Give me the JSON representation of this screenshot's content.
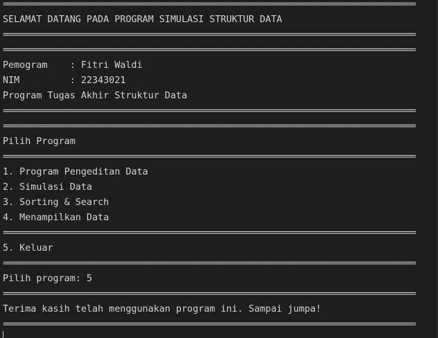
{
  "terminal": {
    "separator": "================================================================================================",
    "lines": {
      "welcome": "SELAMAT DATANG PADA PROGRAM SIMULASI STRUKTUR DATA",
      "programmer": "Pemogram    : Fitri Waldi",
      "nim": "NIM         : 22343021",
      "subtitle": "Program Tugas Akhir Struktur Data",
      "choose_heading": "Pilih Program",
      "menu_1": "1. Program Pengeditan Data",
      "menu_2": "2. Simulasi Data",
      "menu_3": "3. Sorting & Search",
      "menu_4": "4. Menampilkan Data",
      "menu_5": "5. Keluar",
      "prompt": "Pilih program: 5",
      "goodbye": "Terima kasih telah menggunakan program ini. Sampai jumpa!"
    }
  }
}
